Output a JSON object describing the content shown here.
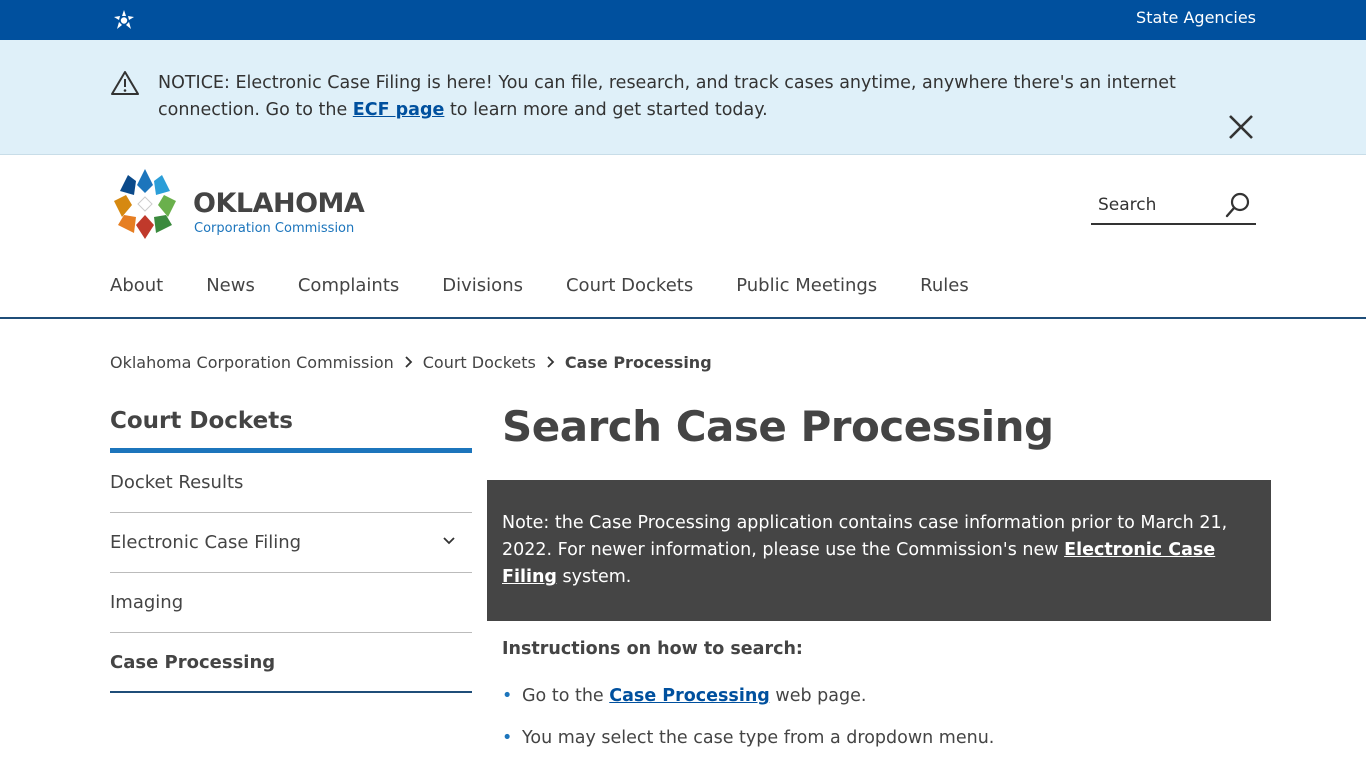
{
  "topbar": {
    "agencies_label": "State Agencies",
    "brand_color": "#00509e"
  },
  "notice": {
    "text_before": "NOTICE: Electronic Case Filing is here! You can file, research, and track cases anytime, anywhere there's an internet connection. Go to the ",
    "link_label": "ECF page",
    "text_after": " to learn more and get started today.",
    "bg_color": "#dff0f9"
  },
  "header": {
    "logo_name": "OKLAHOMA",
    "logo_sub": "Corporation Commission",
    "search_placeholder": "Search"
  },
  "nav": {
    "items": [
      "About",
      "News",
      "Complaints",
      "Divisions",
      "Court Dockets",
      "Public Meetings",
      "Rules"
    ]
  },
  "breadcrumb": {
    "items": [
      "Oklahoma Corporation Commission",
      "Court Dockets"
    ],
    "current": "Case Processing"
  },
  "sidebar": {
    "title": "Court Dockets",
    "items": [
      {
        "label": "Docket Results"
      },
      {
        "label": "Electronic Case Filing"
      },
      {
        "label": "Imaging"
      },
      {
        "label": "Case Processing"
      }
    ],
    "accent_color": "#1c75bc"
  },
  "main": {
    "title": "Search Case Processing",
    "note_before": "Note: the Case Processing application contains case information prior to March 21, 2022. For newer information, please use the Commission's new ",
    "note_link": "Electronic Case Filing",
    "note_after": " system.",
    "instructions_heading": "Instructions on how to search:",
    "step1_before": "Go to the ",
    "step1_link": "Case Processing",
    "step1_after": " web page.",
    "step2": "You may select the case type from a dropdown menu."
  }
}
